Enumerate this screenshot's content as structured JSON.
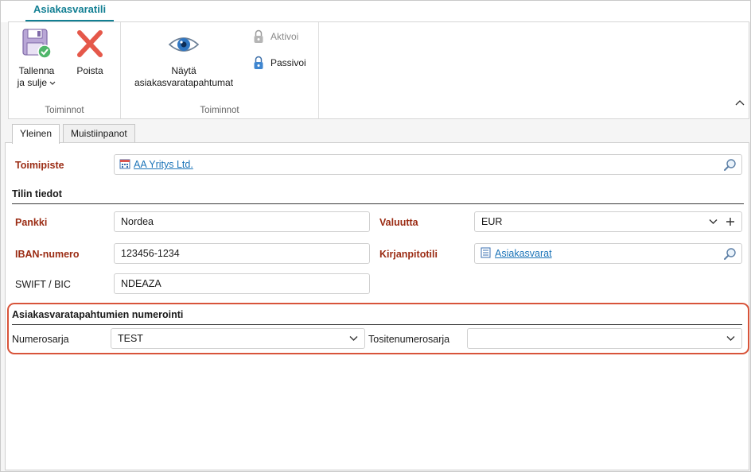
{
  "ribbon": {
    "tab_label": "Asiakasvaratili",
    "groups": [
      {
        "title": "Toiminnot",
        "buttons": [
          {
            "label_line1": "Tallenna",
            "label_line2": "ja sulje",
            "icon": "save-icon"
          },
          {
            "label": "Poista",
            "icon": "delete-x-icon"
          }
        ]
      },
      {
        "title": "Toiminnot",
        "buttons": [
          {
            "label_line1": "Näytä",
            "label_line2": "asiakasvaratapahtumat",
            "icon": "eye-icon"
          },
          {
            "label": "Aktivoi",
            "icon": "lock-icon",
            "disabled": true
          },
          {
            "label": "Passivoi",
            "icon": "lock-icon"
          }
        ]
      }
    ]
  },
  "tabs": [
    {
      "label": "Yleinen",
      "active": true
    },
    {
      "label": "Muistiinpanot",
      "active": false
    }
  ],
  "form": {
    "toimipiste": {
      "label": "Toimipiste",
      "value": "AA Yritys Ltd."
    },
    "section_account": "Tilin tiedot",
    "pankki": {
      "label": "Pankki",
      "value": "Nordea"
    },
    "iban": {
      "label": "IBAN-numero",
      "value": "123456-1234"
    },
    "swift": {
      "label": "SWIFT / BIC",
      "value": "NDEAZA"
    },
    "valuutta": {
      "label": "Valuutta",
      "value": "EUR"
    },
    "kirjanpitotili": {
      "label": "Kirjanpitotili",
      "value": "Asiakasvarat"
    },
    "section_numbering": "Asiakasvaratapahtumien numerointi",
    "numerosarja": {
      "label": "Numerosarja",
      "value": "TEST"
    },
    "tositenumerosarja": {
      "label": "Tositenumerosarja",
      "value": ""
    }
  },
  "colors": {
    "accent": "#127f93",
    "required_label": "#9b2c14",
    "highlight": "#d8543a",
    "link": "#1c74b8"
  }
}
